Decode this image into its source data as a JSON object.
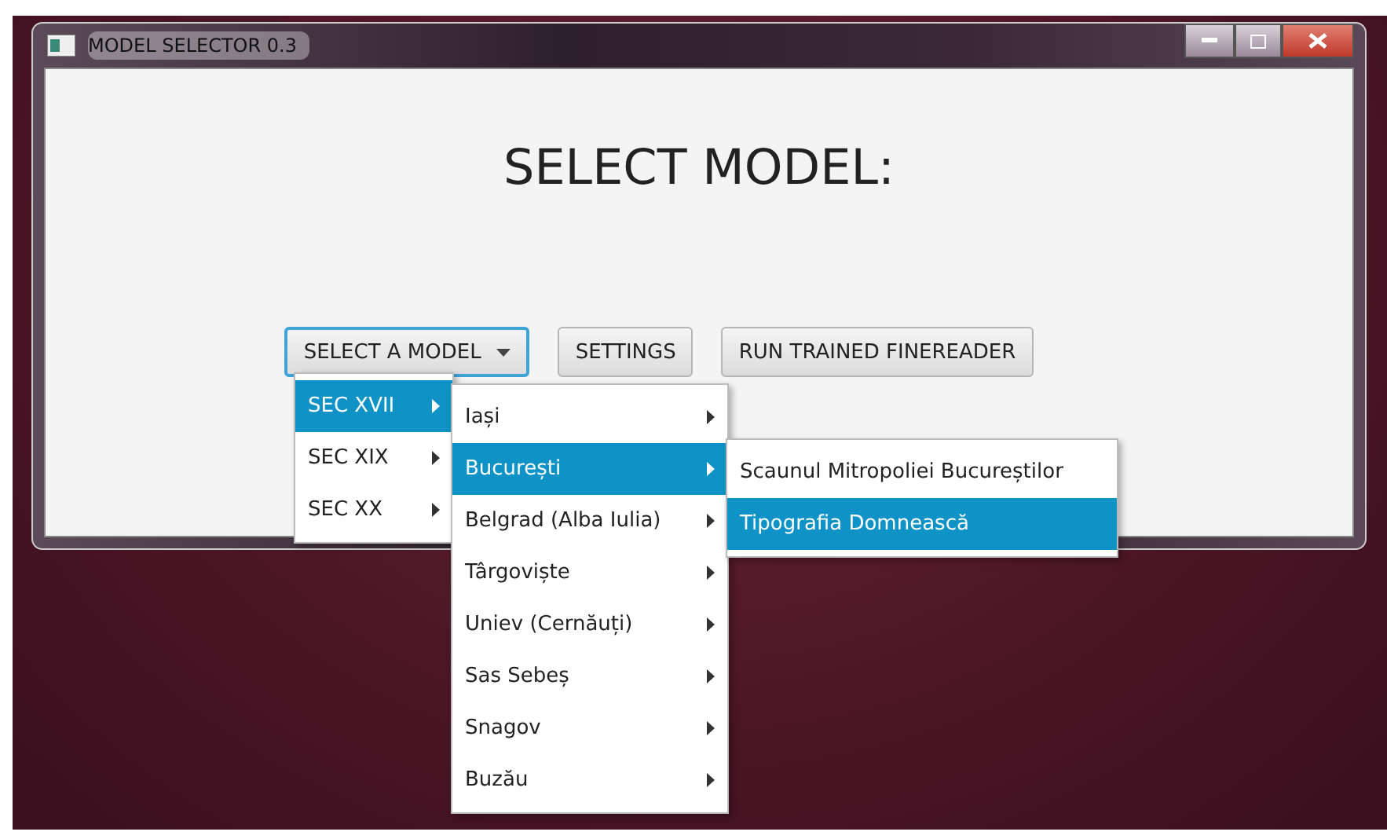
{
  "window": {
    "title": "MODEL SELECTOR 0.3"
  },
  "heading": "SELECT MODEL:",
  "buttons": [
    {
      "label": "SELECT A MODEL",
      "kind": "dropdown",
      "focused": true
    },
    {
      "label": "SETTINGS",
      "kind": "plain",
      "focused": false
    },
    {
      "label": "RUN TRAINED FINEREADER",
      "kind": "plain",
      "focused": false
    }
  ],
  "menus": [
    {
      "items": [
        {
          "label": "SEC XVII",
          "selected": true,
          "submenu": true
        },
        {
          "label": "SEC XIX",
          "selected": false,
          "submenu": true
        },
        {
          "label": "SEC XX",
          "selected": false,
          "submenu": true
        }
      ]
    },
    {
      "items": [
        {
          "label": "Iași",
          "selected": false,
          "submenu": true
        },
        {
          "label": "București",
          "selected": true,
          "submenu": true
        },
        {
          "label": "Belgrad (Alba Iulia)",
          "selected": false,
          "submenu": true
        },
        {
          "label": "Târgoviște",
          "selected": false,
          "submenu": true
        },
        {
          "label": "Uniev (Cernăuți)",
          "selected": false,
          "submenu": true
        },
        {
          "label": "Sas Sebeș",
          "selected": false,
          "submenu": true
        },
        {
          "label": "Snagov",
          "selected": false,
          "submenu": true
        },
        {
          "label": "Buzău",
          "selected": false,
          "submenu": true
        }
      ]
    },
    {
      "items": [
        {
          "label": "Scaunul Mitropoliei Bucureștilor",
          "selected": false,
          "submenu": false
        },
        {
          "label": "Tipografia Domnească",
          "selected": true,
          "submenu": false
        }
      ]
    }
  ]
}
